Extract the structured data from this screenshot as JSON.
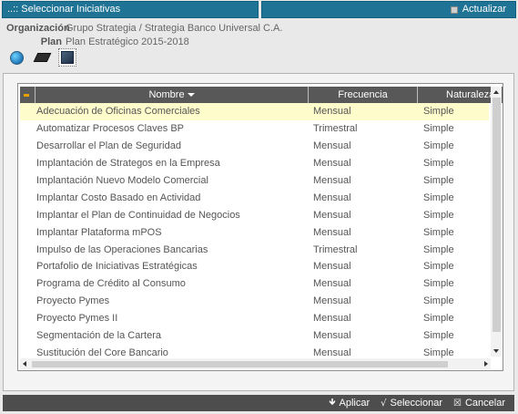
{
  "titlebar": {
    "title": "..:: Seleccionar Iniciativas",
    "refresh_label": "Actualizar"
  },
  "info": {
    "org_label": "Organización",
    "org_value": "Grupo Strategia / Strategia Banco Universal C.A.",
    "plan_label": "Plan",
    "plan_value": "Plan Estratégico 2015-2018"
  },
  "tools": {
    "icons": [
      "globe-icon",
      "book-icon",
      "cube-icon"
    ]
  },
  "grid": {
    "columns": [
      "Nombre",
      "Frecuencia",
      "Naturaleza"
    ],
    "rows": [
      {
        "name": "Adecuación de Oficinas Comerciales",
        "freq": "Mensual",
        "nat": "Simple"
      },
      {
        "name": "Automatizar Procesos Claves BP",
        "freq": "Trimestral",
        "nat": "Simple"
      },
      {
        "name": "Desarrollar el Plan de Seguridad",
        "freq": "Mensual",
        "nat": "Simple"
      },
      {
        "name": "Implantación de Strategos en la Empresa",
        "freq": "Mensual",
        "nat": "Simple"
      },
      {
        "name": "Implantación Nuevo Modelo Comercial",
        "freq": "Mensual",
        "nat": "Simple"
      },
      {
        "name": "Implantar Costo Basado en Actividad",
        "freq": "Mensual",
        "nat": "Simple"
      },
      {
        "name": "Implantar el Plan de Continuidad de Negocios",
        "freq": "Mensual",
        "nat": "Simple"
      },
      {
        "name": "Implantar Plataforma mPOS",
        "freq": "Mensual",
        "nat": "Simple"
      },
      {
        "name": "Impulso de las Operaciones Bancarias",
        "freq": "Trimestral",
        "nat": "Simple"
      },
      {
        "name": "Portafolio de Iniciativas Estratégicas",
        "freq": "Mensual",
        "nat": "Simple"
      },
      {
        "name": "Programa de Crédito al Consumo",
        "freq": "Mensual",
        "nat": "Simple"
      },
      {
        "name": "Proyecto Pymes",
        "freq": "Mensual",
        "nat": "Simple"
      },
      {
        "name": "Proyecto Pymes II",
        "freq": "Mensual",
        "nat": "Simple"
      },
      {
        "name": "Segmentación de la Cartera",
        "freq": "Mensual",
        "nat": "Simple"
      },
      {
        "name": "Sustitución del Core Bancario",
        "freq": "Mensual",
        "nat": "Simple"
      }
    ]
  },
  "footer": {
    "apply_label": "Aplicar",
    "select_label": "Seleccionar",
    "cancel_label": "Cancelar"
  },
  "colors": {
    "title_bg": "#1f7394",
    "header_bg": "#585858",
    "selected_row_bg": "#fffccc",
    "footer_bg": "#4d4d4d"
  }
}
